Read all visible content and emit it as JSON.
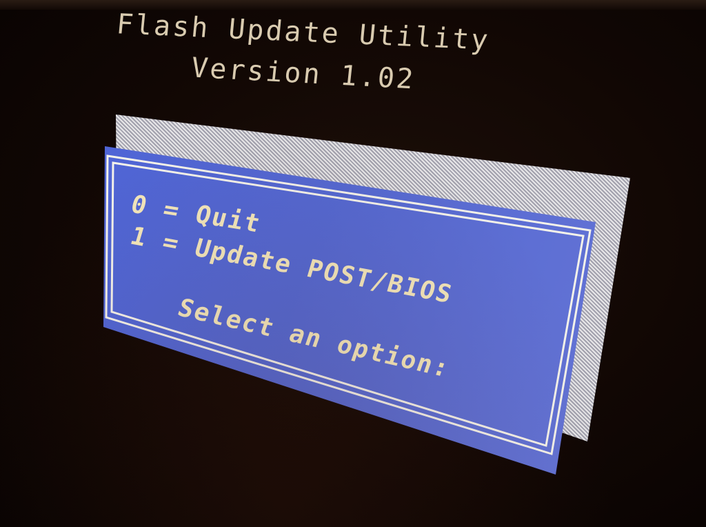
{
  "header": {
    "title": "Flash Update Utility",
    "version": "Version 1.02"
  },
  "dialog": {
    "options": [
      {
        "label": "0 = Quit"
      },
      {
        "label": "1 = Update POST/BIOS"
      }
    ],
    "prompt": "Select an option:"
  },
  "colors": {
    "background": "#120905",
    "dialog_fill": "#5468d2",
    "dialog_text": "#f3e7bc",
    "frame_line": "#f4f2ea",
    "shadow_dither": "#a9a9b6",
    "header_text": "#d9cbb0"
  }
}
